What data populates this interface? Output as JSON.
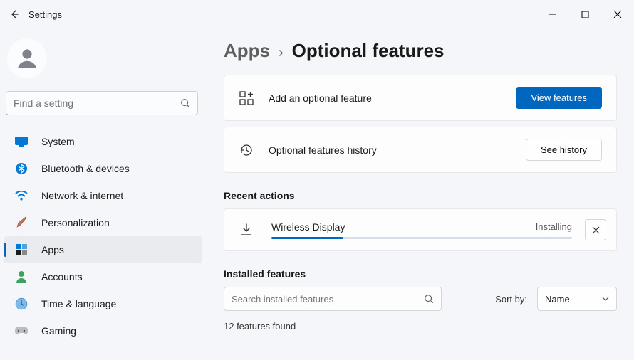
{
  "window": {
    "title": "Settings"
  },
  "sidebar": {
    "search_placeholder": "Find a setting",
    "items": [
      {
        "label": "System"
      },
      {
        "label": "Bluetooth & devices"
      },
      {
        "label": "Network & internet"
      },
      {
        "label": "Personalization"
      },
      {
        "label": "Apps"
      },
      {
        "label": "Accounts"
      },
      {
        "label": "Time & language"
      },
      {
        "label": "Gaming"
      }
    ]
  },
  "breadcrumb": {
    "parent": "Apps",
    "current": "Optional features"
  },
  "cards": {
    "add": {
      "label": "Add an optional feature",
      "button": "View features"
    },
    "history": {
      "label": "Optional features history",
      "button": "See history"
    }
  },
  "recent": {
    "heading": "Recent actions",
    "item": {
      "name": "Wireless Display",
      "status": "Installing"
    }
  },
  "installed": {
    "heading": "Installed features",
    "search_placeholder": "Search installed features",
    "sort_label": "Sort by:",
    "sort_value": "Name",
    "found_text": "12 features found"
  }
}
